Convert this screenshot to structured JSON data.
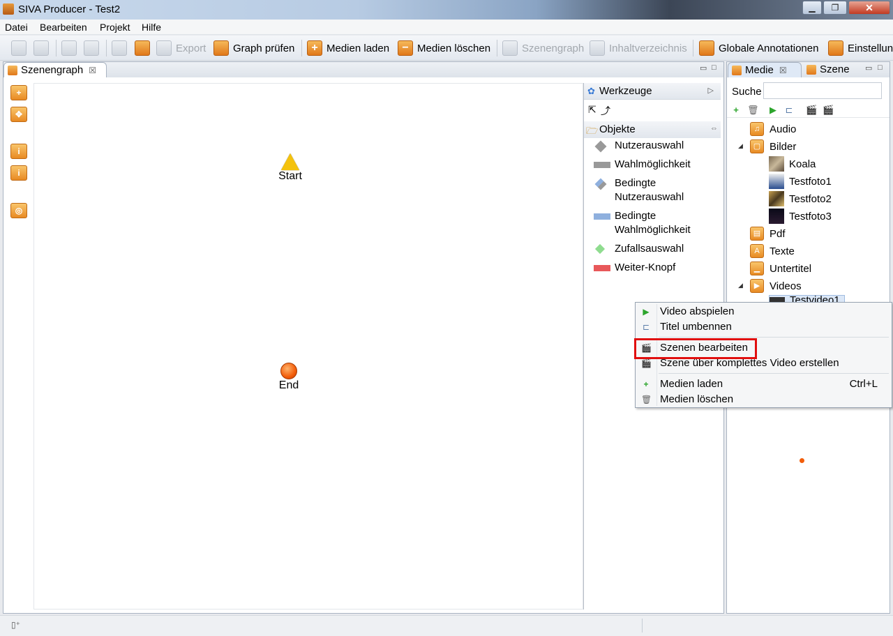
{
  "window": {
    "title": "SIVA Producer - Test2",
    "minimize": "▁",
    "maximize": "❐",
    "close": "✕"
  },
  "menubar": [
    "Datei",
    "Bearbeiten",
    "Projekt",
    "Hilfe"
  ],
  "toolbar": {
    "export": "Export",
    "graph_pruefen": "Graph prüfen",
    "medien_laden": "Medien laden",
    "medien_loeschen": "Medien löschen",
    "szenengraph": "Szenengraph",
    "inhaltverzeichnis": "Inhaltverzeichnis",
    "globale_annotationen": "Globale Annotationen",
    "einstellungen": "Einstellung"
  },
  "editor": {
    "tab_label": "Szenengraph",
    "close_glyph": "☒",
    "nodes": {
      "start": "Start",
      "end": "End"
    }
  },
  "palette": {
    "werkzeuge": "Werkzeuge",
    "objekte": "Objekte",
    "items": [
      "Nutzerauswahl",
      "Wahlmöglichkeit",
      "Bedingte Nutzerauswahl",
      "Bedingte Wahlmöglichkeit",
      "Zufallsauswahl",
      "Weiter-Knopf"
    ]
  },
  "rightpanel": {
    "tabs": [
      "Medie",
      "Szene"
    ],
    "search_label": "Suche",
    "search_value": "",
    "tree": {
      "audio": "Audio",
      "bilder": "Bilder",
      "bilder_children": [
        "Koala",
        "Testfoto1",
        "Testfoto2",
        "Testfoto3"
      ],
      "pdf": "Pdf",
      "texte": "Texte",
      "untertitel": "Untertitel",
      "videos": "Videos",
      "video_child": "Testvideo1"
    }
  },
  "context_menu": {
    "items": [
      {
        "label": "Video abspielen",
        "shortcut": ""
      },
      {
        "label": "Titel umbennen",
        "shortcut": ""
      },
      {
        "label": "Szenen bearbeiten",
        "shortcut": ""
      },
      {
        "label": "Szene über komplettes Video erstellen",
        "shortcut": ""
      },
      {
        "label": "Medien laden",
        "shortcut": "Ctrl+L"
      },
      {
        "label": "Medien löschen",
        "shortcut": ""
      }
    ]
  },
  "colors": {
    "accent_orange": "#e88a23",
    "highlight_red": "#e10f0f",
    "start_yellow": "#f4c20d"
  }
}
